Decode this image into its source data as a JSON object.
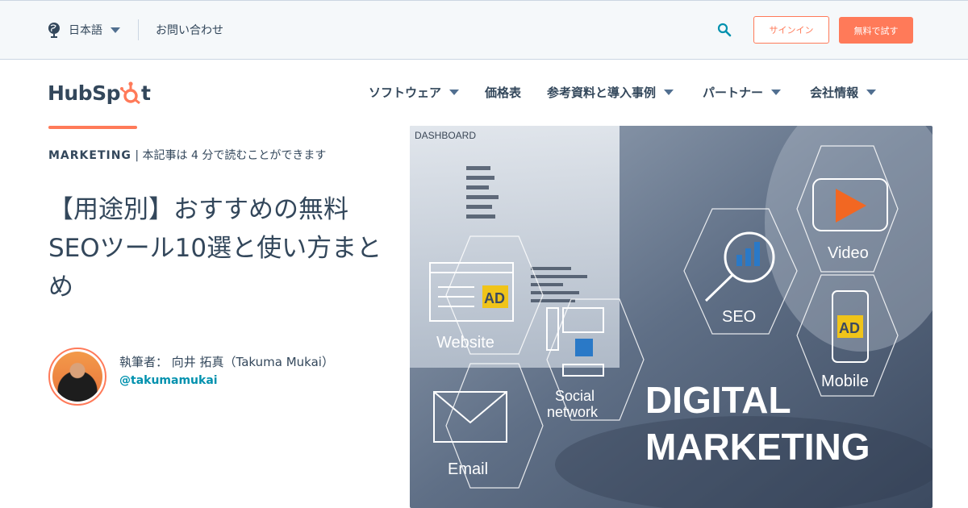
{
  "utility": {
    "language": "日本語",
    "contact": "お問い合わせ",
    "signin": "サインイン",
    "trial": "無料で試す"
  },
  "nav": {
    "logo": {
      "text_left": "HubSp",
      "text_right": "t"
    },
    "items": [
      {
        "label": "ソフトウェア",
        "dropdown": true
      },
      {
        "label": "価格表",
        "dropdown": false
      },
      {
        "label": "参考資料と導入事例",
        "dropdown": true
      },
      {
        "label": "パートナー",
        "dropdown": true
      },
      {
        "label": "会社情報",
        "dropdown": true
      }
    ]
  },
  "article": {
    "topic": "MARKETING",
    "read_time": " | 本記事は 4 分で読むことができます",
    "title_lines": [
      "【用途別】おすすめの無料",
      "SEOツール10選と使い方まと",
      "め"
    ],
    "author_name": "執筆者： 向井 拓真（Takuma Mukai）",
    "author_handle": "@takumamukai"
  },
  "hero": {
    "dashboard_label": "DASHBOARD",
    "labels": {
      "website": "Website",
      "social_line1": "Social",
      "social_line2": "network",
      "email": "Email",
      "seo": "SEO",
      "video": "Video",
      "mobile": "Mobile",
      "ad": "AD",
      "big_line1": "DIGITAL",
      "big_line2": "MARKETING"
    }
  },
  "colors": {
    "brand_orange": "#ff7a59",
    "text_dark": "#33475b",
    "link_teal": "#0091ae",
    "utility_bg": "#f5f8fa"
  }
}
